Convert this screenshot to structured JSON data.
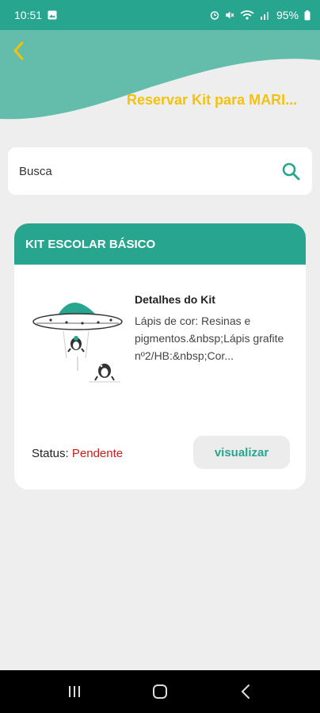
{
  "status_bar": {
    "time": "10:51",
    "battery": "95%",
    "icons": [
      "image-icon",
      "alarm-icon",
      "mute-icon",
      "wifi-icon",
      "signal-icon",
      "battery-icon"
    ]
  },
  "header": {
    "title": "Reservar Kit para MARI...",
    "back_icon": "chevron-left-icon",
    "title_color": "#f4c20d",
    "accent_color": "#27a58f"
  },
  "search": {
    "placeholder": "Busca",
    "icon": "search-icon"
  },
  "kit_card": {
    "title": "KIT ESCOLAR BÁSICO",
    "details_title": "Detalhes do Kit",
    "details_description": "Lápis de cor: Resinas e pigmentos.&nbsp;Lápis grafite nº2/HB:&nbsp;Cor...",
    "status_label": "Status:",
    "status_value": "Pendente",
    "status_color": "#cf1b1b",
    "view_button": "visualizar",
    "illustration": "ufo-penguins-illustration"
  },
  "nav_bar": {
    "buttons": [
      "recent-apps-icon",
      "home-icon",
      "back-icon"
    ]
  }
}
